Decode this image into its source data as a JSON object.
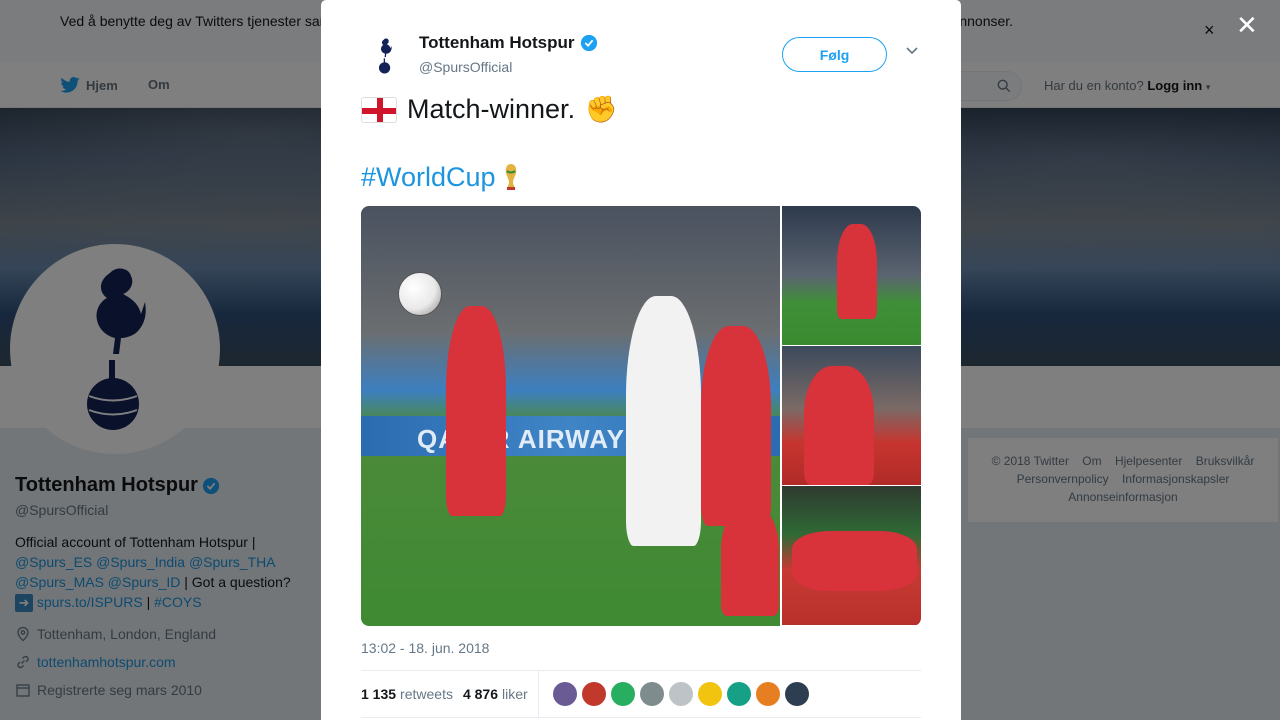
{
  "cookie_bar": {
    "text": "Ved å benytte deg av Twitters tjenester samtykker du i at vi og våre partnere kan bruke informasjonskapsler til bl.a. analyser, personalisering og annonser.",
    "close_glyph": "×"
  },
  "nav": {
    "home_label": "Hjem",
    "about_label": "Om",
    "login_prompt": "Har du en konto?",
    "login_link": "Logg inn"
  },
  "profile": {
    "name": "Tottenham Hotspur",
    "handle": "@SpursOfficial",
    "bio_line1": "Official account of Tottenham Hotspur |",
    "bio_mentions1": "@Spurs_ES @Spurs_India @Spurs_THA",
    "bio_mentions2": "@Spurs_MAS @Spurs_ID",
    "bio_question": "| Got a question?",
    "bio_link": "spurs.to/ISPURS",
    "bio_separator": "|",
    "bio_hashtag": "#COYS",
    "location": "Tottenham, London, England",
    "website": "tottenhamhotspur.com",
    "joined": "Registrerte seg mars 2010"
  },
  "footer": {
    "items": [
      "© 2018 Twitter",
      "Om",
      "Hjelpesenter",
      "Bruksvilkår",
      "Personvernpolicy",
      "Informasjonskapsler",
      "Annonseinformasjon"
    ]
  },
  "overlay": {
    "close_glyph": "✕"
  },
  "tweet": {
    "author_name": "Tottenham Hotspur",
    "author_handle": "@SpursOfficial",
    "follow_label": "Følg",
    "text_line1": "Match-winner.",
    "hashtag": "#WorldCup",
    "ad_text": "QATAR AIRWAYS",
    "timestamp": "13:02 - 18. jun. 2018",
    "retweets_count": "1 135",
    "retweets_label": "retweets",
    "likes_count": "4 876",
    "likes_label": "liker",
    "liker_colors": [
      "#6b5b95",
      "#c0392b",
      "#27ae60",
      "#7f8c8d",
      "#bdc3c7",
      "#f1c40f",
      "#16a085",
      "#e67e22",
      "#2c3e50"
    ]
  },
  "colors": {
    "accent": "#1da1f2",
    "link": "#1b95e0",
    "spurs_navy": "#132257"
  }
}
